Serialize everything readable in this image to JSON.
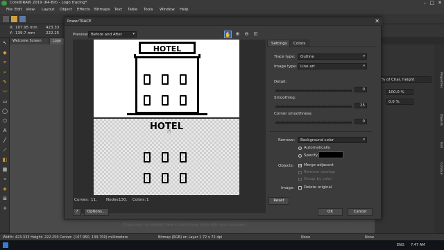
{
  "app": {
    "title": "CorelDRAW 2019 (64-Bit) - Logo tracing*",
    "menu": [
      "File",
      "Edit",
      "View",
      "Layout",
      "Object",
      "Effects",
      "Bitmaps",
      "Text",
      "Table",
      "Tools",
      "Window",
      "Help"
    ],
    "doc_tabs": [
      "Welcome Screen",
      "Logo"
    ],
    "coords": {
      "x": "107.95 mm",
      "y": "139.7 mm",
      "w": "423.33",
      "h": "222.25"
    }
  },
  "right_panel": {
    "char_height": "% of Char. height",
    "pct1": "100.0 %",
    "pct2": "0.0 %"
  },
  "dock_tabs": [
    "Properties",
    "Objects",
    "Text",
    "Contour"
  ],
  "dialog": {
    "title": "PowerTRACE",
    "preview_label": "Preview:",
    "preview_mode": "Before and After",
    "preview_text": "HOTEL",
    "stats": {
      "curves_label": "Curves:",
      "curves": "11,",
      "nodes_label": "Nodes:",
      "nodes": "130,",
      "colors_label": "Colors:",
      "colors": "1"
    },
    "tabs": [
      "Settings",
      "Colors"
    ],
    "trace_type_label": "Trace type:",
    "trace_type": "Outline",
    "image_type_label": "Image type:",
    "image_type": "Line art",
    "detail_label": "Detail:",
    "detail_value": "0",
    "smoothing_label": "Smoothing:",
    "smoothing_value": "25",
    "corner_label": "Corner smoothness:",
    "corner_value": "0",
    "remove_label": "Remove:",
    "remove_value": "Background color",
    "auto_label": "Automatically",
    "specify_label": "Specify",
    "specify_color": "#000000",
    "objects_label": "Objects:",
    "merge_label": "Merge adjacent",
    "remove_overlap_label": "Remove overlap",
    "group_label": "Group by color",
    "image_label": "Image:",
    "delete_label": "Delete original",
    "reset_label": "Reset",
    "help_label": "?",
    "options_label": "Options...",
    "ok_label": "OK",
    "cancel_label": "Cancel"
  },
  "status": {
    "left": "Width: 423.333  Height: 222.250  Center: (107.950, 139.700)  millimeters",
    "mid": "Bitmap (RGB) on Layer 1 72 x 72 dpi",
    "hint": "Drag colors (or objects) here to store these colors with your document",
    "fill_none": "None",
    "outline_none": "None"
  },
  "taskbar": {
    "lang": "ENG",
    "time": "7:47 AM"
  },
  "colors": {
    "accent": "#e0a030",
    "dialog_bg": "#3b3b3b"
  }
}
